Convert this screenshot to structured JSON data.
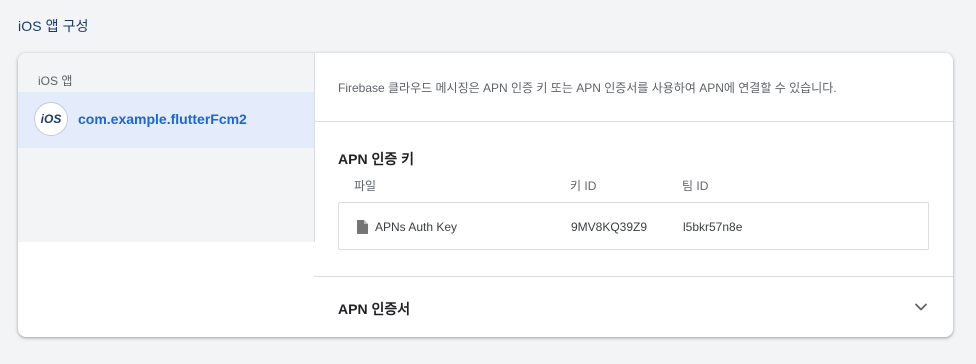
{
  "section": {
    "title": "iOS 앱 구성"
  },
  "sidebar": {
    "label": "iOS 앱",
    "app": {
      "badge": "iOS",
      "bundle_id": "com.example.flutterFcm2"
    }
  },
  "main": {
    "intro": "Firebase 클라우드 메시징은 APN 인증 키 또는 APN 인증서를 사용하여 APN에 연결할 수 있습니다.",
    "auth_key": {
      "title": "APN 인증 키",
      "columns": [
        "파일",
        "키 ID",
        "팀 ID"
      ],
      "row": {
        "file": "APNs Auth Key",
        "key_id": "9MV8KQ39Z9",
        "team_id": "l5bkr57n8e"
      }
    },
    "certificate": {
      "title": "APN 인증서"
    }
  },
  "icons": {
    "file": "file-icon",
    "expand": "chevron-down-icon"
  },
  "colors": {
    "accent": "#1967d2",
    "selected_bg": "#e4ecfb"
  }
}
